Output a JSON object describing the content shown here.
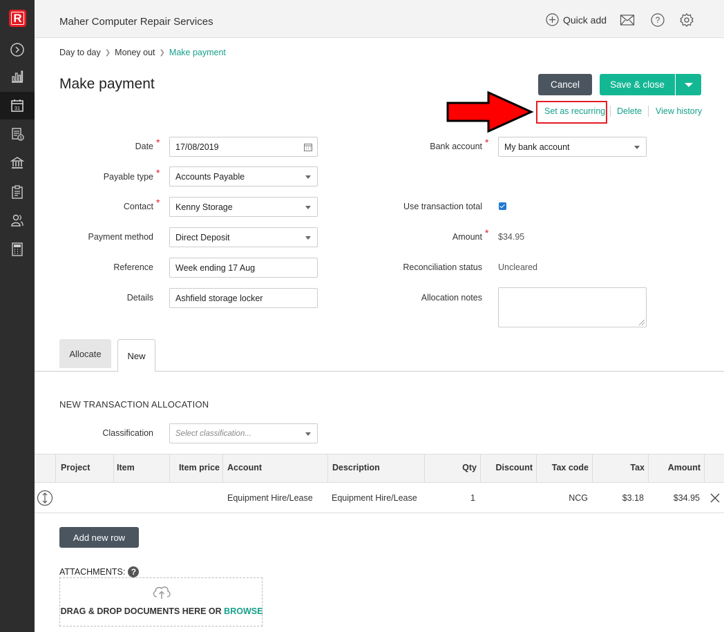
{
  "app": {
    "logo": "R",
    "company": "Maher Computer Repair Services"
  },
  "header": {
    "quick_add": "Quick add",
    "icons": [
      "plus-circle-icon",
      "mail-icon",
      "help-icon",
      "gear-icon"
    ]
  },
  "sidebar": {
    "items": [
      "expand-icon",
      "dashboard-icon",
      "calendar-icon",
      "billing-icon",
      "bank-icon",
      "reports-icon",
      "contacts-icon",
      "calculator-icon"
    ],
    "calendar_day": "31"
  },
  "breadcrumb": [
    "Day to day",
    "Money out",
    "Make payment"
  ],
  "page": {
    "title": "Make payment"
  },
  "actions": {
    "cancel": "Cancel",
    "save_close": "Save & close",
    "set_recurring": "Set as recurring",
    "delete": "Delete",
    "view_history": "View history"
  },
  "form": {
    "date_label": "Date",
    "date_value": "17/08/2019",
    "payable_type_label": "Payable type",
    "payable_type_value": "Accounts Payable",
    "contact_label": "Contact",
    "contact_value": "Kenny Storage",
    "payment_method_label": "Payment method",
    "payment_method_value": "Direct Deposit",
    "reference_label": "Reference",
    "reference_value": "Week ending 17 Aug",
    "details_label": "Details",
    "details_value": "Ashfield storage locker",
    "bank_account_label": "Bank account",
    "bank_account_value": "My bank account",
    "use_total_label": "Use transaction total",
    "amount_label": "Amount",
    "amount_value": "$34.95",
    "reconciliation_label": "Reconciliation status",
    "reconciliation_value": "Uncleared",
    "allocation_notes_label": "Allocation notes"
  },
  "tabs": [
    "Allocate",
    "New"
  ],
  "allocation": {
    "title": "NEW TRANSACTION ALLOCATION",
    "classification_label": "Classification",
    "classification_placeholder": "Select classification..."
  },
  "table": {
    "headers": [
      "Project",
      "Item",
      "Item price",
      "Account",
      "Description",
      "Qty",
      "Discount",
      "Tax code",
      "Tax",
      "Amount"
    ],
    "row": {
      "account": "Equipment Hire/Lease",
      "description": "Equipment Hire/Lease",
      "qty": "1",
      "tax_code": "NCG",
      "tax": "$3.18",
      "amount": "$34.95"
    }
  },
  "add_row": "Add new row",
  "attachments": {
    "label": "ATTACHMENTS:",
    "help": "?",
    "drop_text": "DRAG & DROP DOCUMENTS HERE OR",
    "browse": "BROWSE"
  }
}
